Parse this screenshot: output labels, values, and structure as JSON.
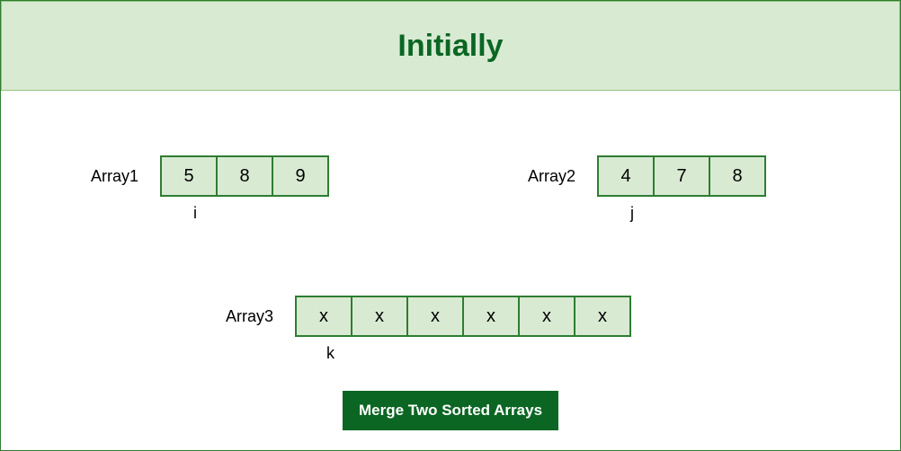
{
  "title": "Initially",
  "array1": {
    "label": "Array1",
    "values": [
      "5",
      "8",
      "9"
    ],
    "pointer": "i"
  },
  "array2": {
    "label": "Array2",
    "values": [
      "4",
      "7",
      "8"
    ],
    "pointer": "j"
  },
  "array3": {
    "label": "Array3",
    "values": [
      "x",
      "x",
      "x",
      "x",
      "x",
      "x"
    ],
    "pointer": "k"
  },
  "button_label": "Merge Two Sorted Arrays"
}
